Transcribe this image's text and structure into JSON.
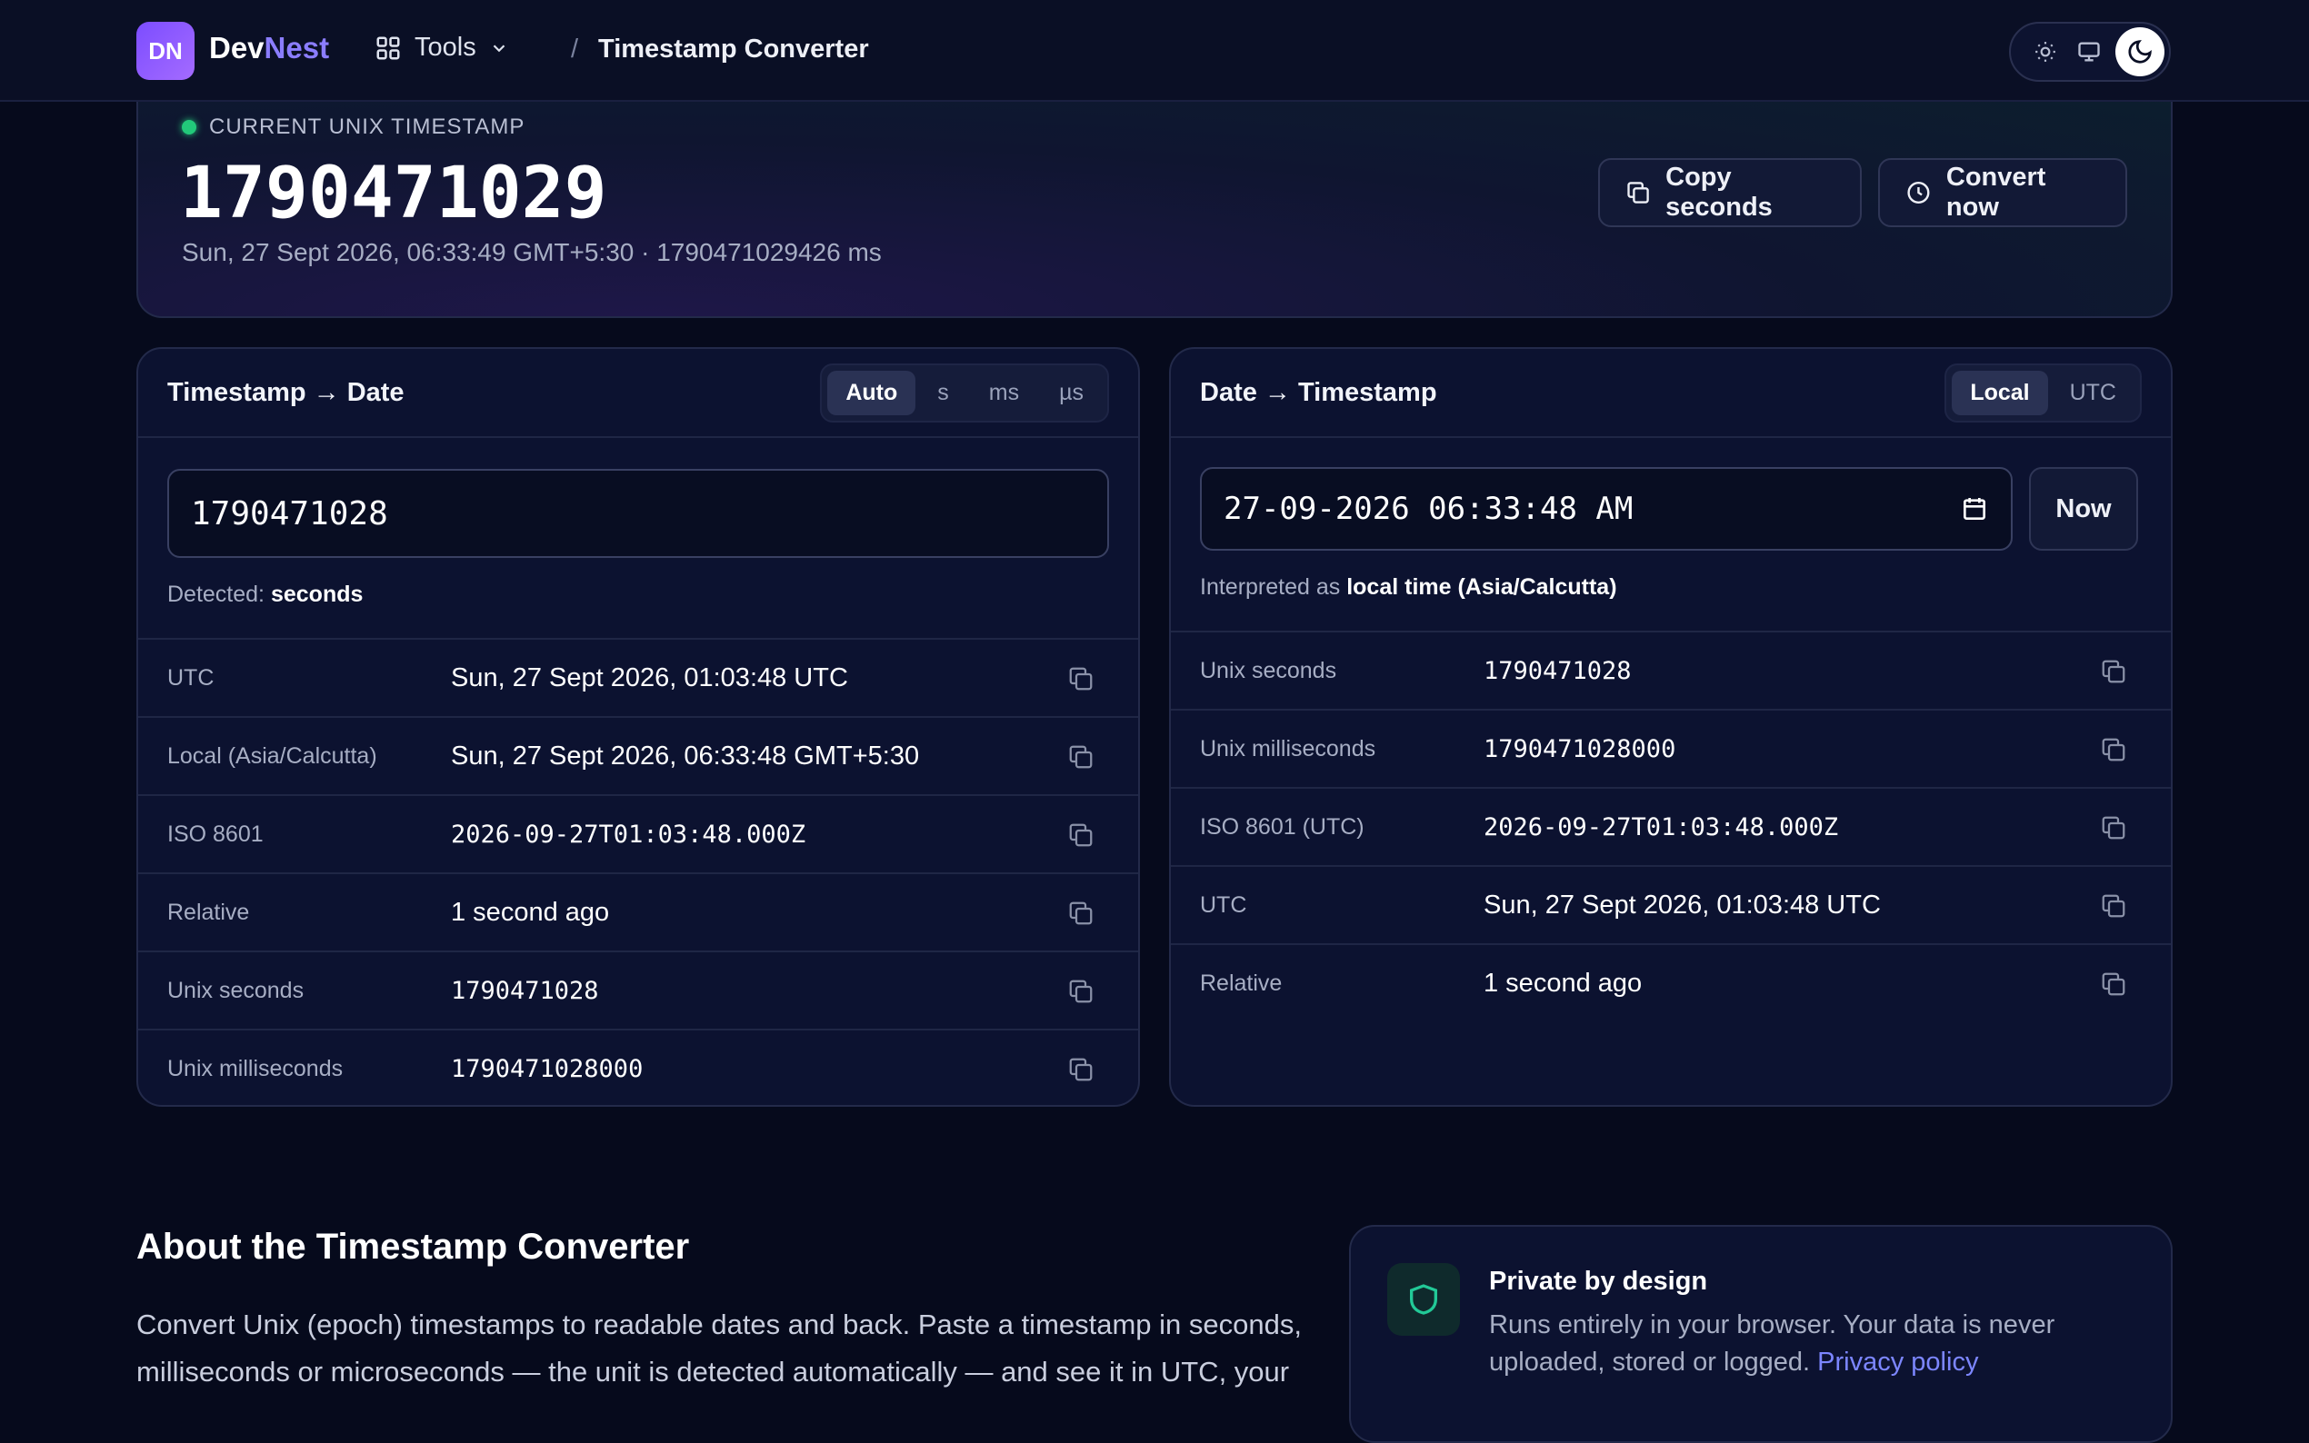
{
  "nav": {
    "logo": "DN",
    "brand_a": "Dev",
    "brand_b": "Nest",
    "tools_label": "Tools",
    "crumb_sep": "/",
    "crumb_title": "Timestamp Converter",
    "theme": {
      "options": [
        "sun-icon",
        "monitor-icon",
        "moon-icon"
      ],
      "active": "moon-icon"
    }
  },
  "hero": {
    "label": "CURRENT UNIX TIMESTAMP",
    "value": "1790471029",
    "sub": "Sun, 27 Sept 2026, 06:33:49 GMT+5:30 · 1790471029426 ms",
    "copy_label": "Copy seconds",
    "convert_label": "Convert now"
  },
  "left": {
    "title": "Timestamp → Date",
    "units": [
      "Auto",
      "s",
      "ms",
      "µs"
    ],
    "input_value": "1790471028",
    "detected_label": "Detected:",
    "detected_value": "seconds",
    "rows": [
      {
        "key": "UTC",
        "value": "Sun, 27 Sept 2026, 01:03:48 UTC"
      },
      {
        "key": "Local (Asia/Calcutta)",
        "value": "Sun, 27 Sept 2026, 06:33:48 GMT+5:30"
      },
      {
        "key": "ISO 8601",
        "value": "2026-09-27T01:03:48.000Z"
      },
      {
        "key": "Relative",
        "value": "1 second ago"
      },
      {
        "key": "Unix seconds",
        "value": "1790471028"
      },
      {
        "key": "Unix milliseconds",
        "value": "1790471028000"
      }
    ]
  },
  "right": {
    "title": "Date → Timestamp",
    "zones": [
      "Local",
      "UTC"
    ],
    "date_value": "27-09-2026 06:33:48 AM",
    "now_label": "Now",
    "interp_label": "Interpreted as",
    "interp_value": "local time (Asia/Calcutta)",
    "rows": [
      {
        "key": "Unix seconds",
        "value": "1790471028"
      },
      {
        "key": "Unix milliseconds",
        "value": "1790471028000"
      },
      {
        "key": "ISO 8601 (UTC)",
        "value": "2026-09-27T01:03:48.000Z"
      },
      {
        "key": "UTC",
        "value": "Sun, 27 Sept 2026, 01:03:48 UTC"
      },
      {
        "key": "Relative",
        "value": "1 second ago"
      }
    ]
  },
  "about": {
    "heading": "About the Timestamp Converter",
    "body": "Convert Unix (epoch) timestamps to readable dates and back. Paste a timestamp in seconds, milliseconds or microseconds — the unit is detected automatically — and see it in UTC, your"
  },
  "privacy": {
    "title": "Private by design",
    "text": "Runs entirely in your browser. Your data is never uploaded, stored or logged.",
    "link": "Privacy policy"
  },
  "colors": {
    "accent": "#7c4dff",
    "live_dot": "#22c97a",
    "link": "#7c86ff",
    "bg": "#060a1c"
  }
}
